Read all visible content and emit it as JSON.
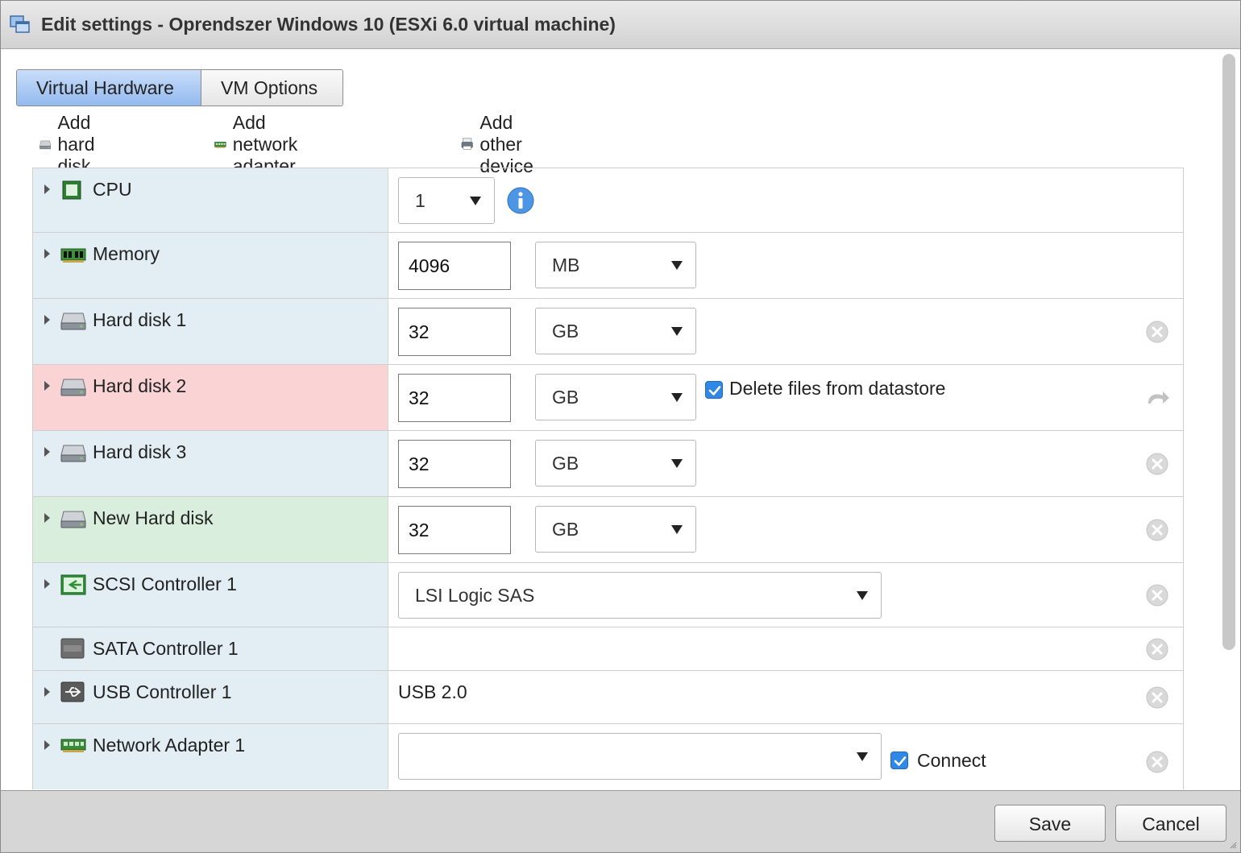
{
  "window": {
    "title": "Edit settings - Oprendszer Windows 10 (ESXi 6.0 virtual machine)"
  },
  "tabs": [
    {
      "label": "Virtual Hardware",
      "active": true
    },
    {
      "label": "VM Options",
      "active": false
    }
  ],
  "toolbar": {
    "add_hard_disk": "Add hard disk",
    "add_network_adapter": "Add network adapter",
    "add_other_device": "Add other device"
  },
  "devices": {
    "cpu": {
      "name": "CPU",
      "value": "1"
    },
    "memory": {
      "name": "Memory",
      "value": "4096",
      "unit": "MB"
    },
    "hard_disk_1": {
      "name": "Hard disk 1",
      "value": "32",
      "unit": "GB"
    },
    "hard_disk_2": {
      "name": "Hard disk 2",
      "value": "32",
      "unit": "GB",
      "delete_files_label": "Delete files from datastore",
      "delete_files_checked": true
    },
    "hard_disk_3": {
      "name": "Hard disk 3",
      "value": "32",
      "unit": "GB"
    },
    "new_hard_disk": {
      "name": "New Hard disk",
      "value": "32",
      "unit": "GB"
    },
    "scsi_controller_1": {
      "name": "SCSI Controller 1",
      "value": "LSI Logic SAS"
    },
    "sata_controller_1": {
      "name": "SATA Controller 1"
    },
    "usb_controller_1": {
      "name": "USB Controller 1",
      "value": "USB 2.0"
    },
    "network_adapter_1": {
      "name": "Network Adapter 1",
      "value": "",
      "connect_label": "Connect",
      "connect_checked": true
    }
  },
  "footer": {
    "save_label": "Save",
    "cancel_label": "Cancel"
  },
  "colors": {
    "active_tab": "#93b9ee",
    "row_label_bg": "#e2edf4",
    "removed_row_bg": "#fad4d4",
    "new_row_bg": "#d9eedd",
    "checkbox": "#2f87e6"
  }
}
